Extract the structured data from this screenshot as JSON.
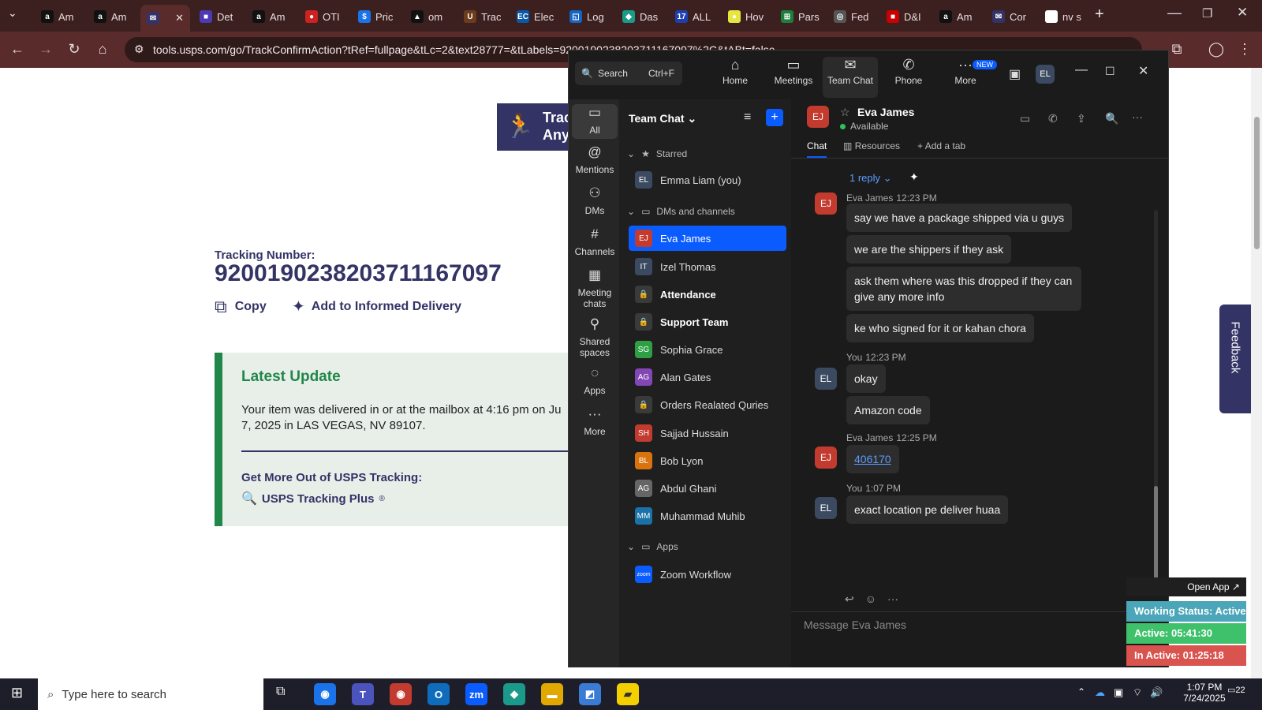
{
  "browser": {
    "tabs": [
      {
        "label": "Am",
        "fav": "a",
        "color": "#111"
      },
      {
        "label": "Am",
        "fav": "a",
        "color": "#111"
      },
      {
        "label": "",
        "fav": "✉",
        "color": "#333366",
        "active": true
      },
      {
        "label": "Det",
        "fav": "■",
        "color": "#4b3ab3"
      },
      {
        "label": "Am",
        "fav": "a",
        "color": "#111"
      },
      {
        "label": "OTI",
        "fav": "●",
        "color": "#c22"
      },
      {
        "label": "Pric",
        "fav": "$",
        "color": "#1a73e8"
      },
      {
        "label": "om",
        "fav": "▲",
        "color": "#111"
      },
      {
        "label": "Trac",
        "fav": "U",
        "color": "#6b3d1b"
      },
      {
        "label": "Elec",
        "fav": "EC",
        "color": "#0a58a8"
      },
      {
        "label": "Log",
        "fav": "◱",
        "color": "#1565c0"
      },
      {
        "label": "Das",
        "fav": "◆",
        "color": "#1a9a8a"
      },
      {
        "label": "ALL",
        "fav": "17",
        "color": "#1e40af"
      },
      {
        "label": "Hov",
        "fav": "●",
        "color": "#e6e640"
      },
      {
        "label": "Pars",
        "fav": "⊞",
        "color": "#1c7f3c"
      },
      {
        "label": "Fed",
        "fav": "◎",
        "color": "#555"
      },
      {
        "label": "D&I",
        "fav": "■",
        "color": "#c00"
      },
      {
        "label": "Am",
        "fav": "a",
        "color": "#111"
      },
      {
        "label": "Cor",
        "fav": "✉",
        "color": "#333366"
      },
      {
        "label": "nv s",
        "fav": "G",
        "color": "#fff"
      }
    ],
    "url": "tools.usps.com/go/TrackConfirmAction?tRef=fullpage&tLc=2&text28777=&tLabels=9200190238203711167097%2C&tABt=false"
  },
  "usps": {
    "banner_text_1": "Trac",
    "banner_text_2": "Any",
    "tracking_label": "Tracking Number:",
    "tracking_number": "9200190238203711167097",
    "copy_label": "Copy",
    "informed_label": "Add to Informed Delivery",
    "latest_update_title": "Latest Update",
    "latest_update_text_1": "Your item was delivered in or at the mailbox at 4:16 pm on Ju",
    "latest_update_text_2": "7, 2025 in LAS VEGAS, NV 89107.",
    "more_title": "Get More Out of USPS Tracking:",
    "tracking_plus": "USPS Tracking Plus",
    "tracking_plus_sup": "®",
    "feedback": "Feedback"
  },
  "zoom": {
    "search_label": "Search",
    "search_shortcut": "Ctrl+F",
    "top_nav": [
      "Home",
      "Meetings",
      "Team Chat",
      "Phone",
      "More"
    ],
    "new_badge": "NEW",
    "user_initials": "EL",
    "left_nav": [
      "All",
      "Mentions",
      "DMs",
      "Channels",
      "Meeting chats",
      "Shared spaces",
      "Apps",
      "More"
    ],
    "list_title": "Team Chat",
    "starred": "Starred",
    "dms_channels": "DMs and channels",
    "apps_section": "Apps",
    "contacts": [
      {
        "name": "Emma Liam (you)",
        "initials": "EL",
        "color": "#3b4a60"
      },
      {
        "name": "Eva James",
        "initials": "EJ",
        "color": "#c23b2e"
      },
      {
        "name": "Izel Thomas",
        "initials": "IT",
        "color": "#3b4a60"
      },
      {
        "name": "Attendance",
        "initials": "🔒",
        "color": "#3a3a3a"
      },
      {
        "name": "Support Team",
        "initials": "🔒",
        "color": "#3a3a3a"
      },
      {
        "name": "Sophia Grace",
        "initials": "SG",
        "color": "#2ea043"
      },
      {
        "name": "Alan Gates",
        "initials": "AG",
        "color": "#8247b5"
      },
      {
        "name": "Orders Realated Quries",
        "initials": "🔒",
        "color": "#3a3a3a"
      },
      {
        "name": "Sajjad Hussain",
        "initials": "SH",
        "color": "#c23b2e"
      },
      {
        "name": "Bob Lyon",
        "initials": "BL",
        "color": "#d9730d"
      },
      {
        "name": "Abdul Ghani",
        "initials": "AG",
        "color": "#666"
      },
      {
        "name": "Muhammad Muhib",
        "initials": "MM",
        "color": "#1a73a8"
      },
      {
        "name": "Zoom Workflow",
        "initials": "zoom",
        "color": "#0b5cff"
      }
    ],
    "chat_header_name": "Eva James",
    "chat_header_status": "Available",
    "chat_header_initials": "EJ",
    "chat_tabs": [
      "Chat",
      "Resources",
      "Add a tab"
    ],
    "reply_label": "1 reply",
    "messages": [
      {
        "sender": "Eva James",
        "time": "12:23 PM",
        "initials": "EJ",
        "color": "#c23b2e",
        "lines": [
          "say we have a package shipped via u guys",
          "we are the shippers if they ask",
          "ask them where was this dropped if they can give any more info",
          "ke who signed for it or kahan chora"
        ]
      },
      {
        "sender": "You",
        "time": "12:23 PM",
        "initials": "EL",
        "color": "#3b4a60",
        "lines": [
          "okay",
          "Amazon code"
        ]
      },
      {
        "sender": "Eva James",
        "time": "12:25 PM",
        "initials": "EJ",
        "color": "#c23b2e",
        "lines": [
          "406170"
        ]
      },
      {
        "sender": "You",
        "time": "1:07 PM",
        "initials": "EL",
        "color": "#3b4a60",
        "lines": [
          "exact location pe deliver huaa"
        ]
      }
    ],
    "compose_placeholder": "Message Eva James"
  },
  "status_widget": {
    "open_app": "Open App ↗",
    "working": "Working Status: Active",
    "active": "Active: 05:41:30",
    "inactive": "In Active: 01:25:18"
  },
  "taskbar": {
    "search_placeholder": "Type here to search",
    "time": "1:07 PM",
    "date": "7/24/2025",
    "notif_count": "22"
  }
}
